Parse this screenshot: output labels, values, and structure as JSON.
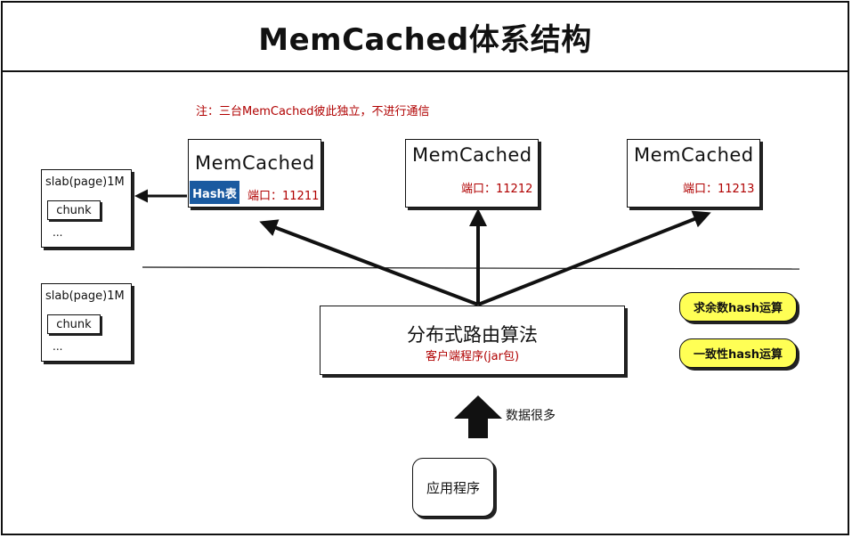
{
  "title": "MemCached体系结构",
  "note": "注：三台MemCached彼此独立，不进行通信",
  "servers": [
    {
      "name": "MemCached",
      "port": "端口：11211",
      "hash_badge": "Hash表"
    },
    {
      "name": "MemCached",
      "port": "端口：11212"
    },
    {
      "name": "MemCached",
      "port": "端口：11213"
    }
  ],
  "slabs": [
    {
      "label": "slab(page)1M",
      "chunk": "chunk",
      "more": "..."
    },
    {
      "label": "slab(page)1M",
      "chunk": "chunk",
      "more": "..."
    }
  ],
  "router": {
    "title": "分布式路由算法",
    "subtitle": "客户端程序(jar包)"
  },
  "algorithms": [
    "求余数hash运算",
    "一致性hash运算"
  ],
  "data_label": "数据很多",
  "app": "应用程序",
  "colors": {
    "note_red": "#b00000",
    "hash_badge_blue": "#1a5aa0",
    "pill_yellow": "#ffff55",
    "line": "#111111"
  }
}
